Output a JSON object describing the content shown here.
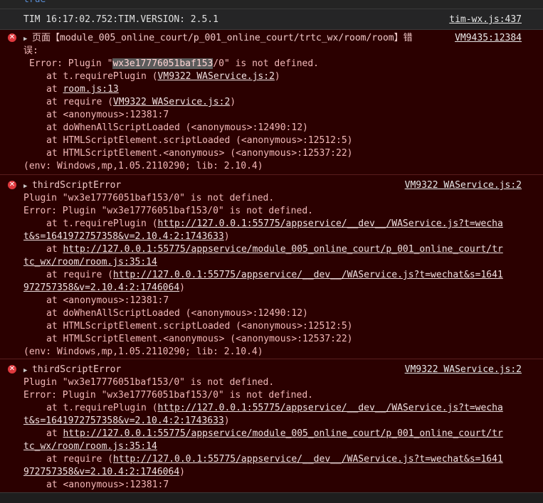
{
  "top_fragment": "true",
  "info_log": {
    "message": "TIM 16:17:02.752:TIM.VERSION: 2.5.1",
    "source": "tim-wx.js:437"
  },
  "error1": {
    "title_line1": "页面【module_005_online_court/p_001_online_court/trtc_wx/room/room】错",
    "title_line2": "误:",
    "source": "VM9435:12384",
    "msg_prefix": "Error: Plugin \"",
    "msg_selected": "wx3e17776051baf153",
    "msg_suffix": "/0\" is not defined.",
    "stack": [
      {
        "pre": "at t.requirePlugin (",
        "link": "VM9322 WAService.js:2",
        "post": ")"
      },
      {
        "pre": "at ",
        "link": "room.js:13",
        "post": ""
      },
      {
        "pre": "at require (",
        "link": "VM9322 WAService.js:2",
        "post": ")"
      },
      {
        "pre": "at <anonymous>:12381:7",
        "link": "",
        "post": ""
      },
      {
        "pre": "at doWhenAllScriptLoaded (<anonymous>:12490:12)",
        "link": "",
        "post": ""
      },
      {
        "pre": "at HTMLScriptElement.scriptLoaded (<anonymous>:12512:5)",
        "link": "",
        "post": ""
      },
      {
        "pre": "at HTMLScriptElement.<anonymous> (<anonymous>:12537:22)",
        "link": "",
        "post": ""
      }
    ],
    "env": "(env: Windows,mp,1.05.2110290; lib: 2.10.4)"
  },
  "error2": {
    "title": "thirdScriptError",
    "source": "VM9322 WAService.js:2",
    "line1": "Plugin \"wx3e17776051baf153/0\" is not defined.",
    "line2": "Error: Plugin \"wx3e17776051baf153/0\" is not defined.",
    "s1_pre": "at t.requirePlugin (",
    "s1_link_a": "http://127.0.0.1:55775/appservice/__dev__/WAService.js?t=wecha",
    "s1_link_b": "t&s=1641972757358&v=2.10.4:2:1743633",
    "s1_post": ")",
    "s2_pre": "at ",
    "s2_link_a": "http://127.0.0.1:55775/appservice/module_005_online_court/p_001_online_court/tr",
    "s2_link_b": "tc_wx/room/room.js:35:14",
    "s3_pre": "at require (",
    "s3_link_a": "http://127.0.0.1:55775/appservice/__dev__/WAService.js?t=wechat&s=1641",
    "s3_link_b": "972757358&v=2.10.4:2:1746064",
    "s3_post": ")",
    "s4": "at <anonymous>:12381:7",
    "s5": "at doWhenAllScriptLoaded (<anonymous>:12490:12)",
    "s6": "at HTMLScriptElement.scriptLoaded (<anonymous>:12512:5)",
    "s7": "at HTMLScriptElement.<anonymous> (<anonymous>:12537:22)",
    "env": "(env: Windows,mp,1.05.2110290; lib: 2.10.4)"
  },
  "error3": {
    "title": "thirdScriptError",
    "source": "VM9322 WAService.js:2",
    "line1": "Plugin \"wx3e17776051baf153/0\" is not defined.",
    "line2": "Error: Plugin \"wx3e17776051baf153/0\" is not defined.",
    "s1_pre": "at t.requirePlugin (",
    "s1_link_a": "http://127.0.0.1:55775/appservice/__dev__/WAService.js?t=wecha",
    "s1_link_b": "t&s=1641972757358&v=2.10.4:2:1743633",
    "s1_post": ")",
    "s2_pre": "at ",
    "s2_link_a": "http://127.0.0.1:55775/appservice/module_005_online_court/p_001_online_court/tr",
    "s2_link_b": "tc_wx/room/room.js:35:14",
    "s3_pre": "at require (",
    "s3_link_a": "http://127.0.0.1:55775/appservice/__dev__/WAService.js?t=wechat&s=1641",
    "s3_link_b": "972757358&v=2.10.4:2:1746064",
    "s3_post": ")",
    "s4": "at <anonymous>:12381:7"
  },
  "icons": {
    "error": "error-x-icon",
    "expand": "triangle-right-icon"
  },
  "colors": {
    "error_bg": "#2b0000",
    "error_text": "#f2b8b8",
    "panel_bg": "#242424"
  }
}
